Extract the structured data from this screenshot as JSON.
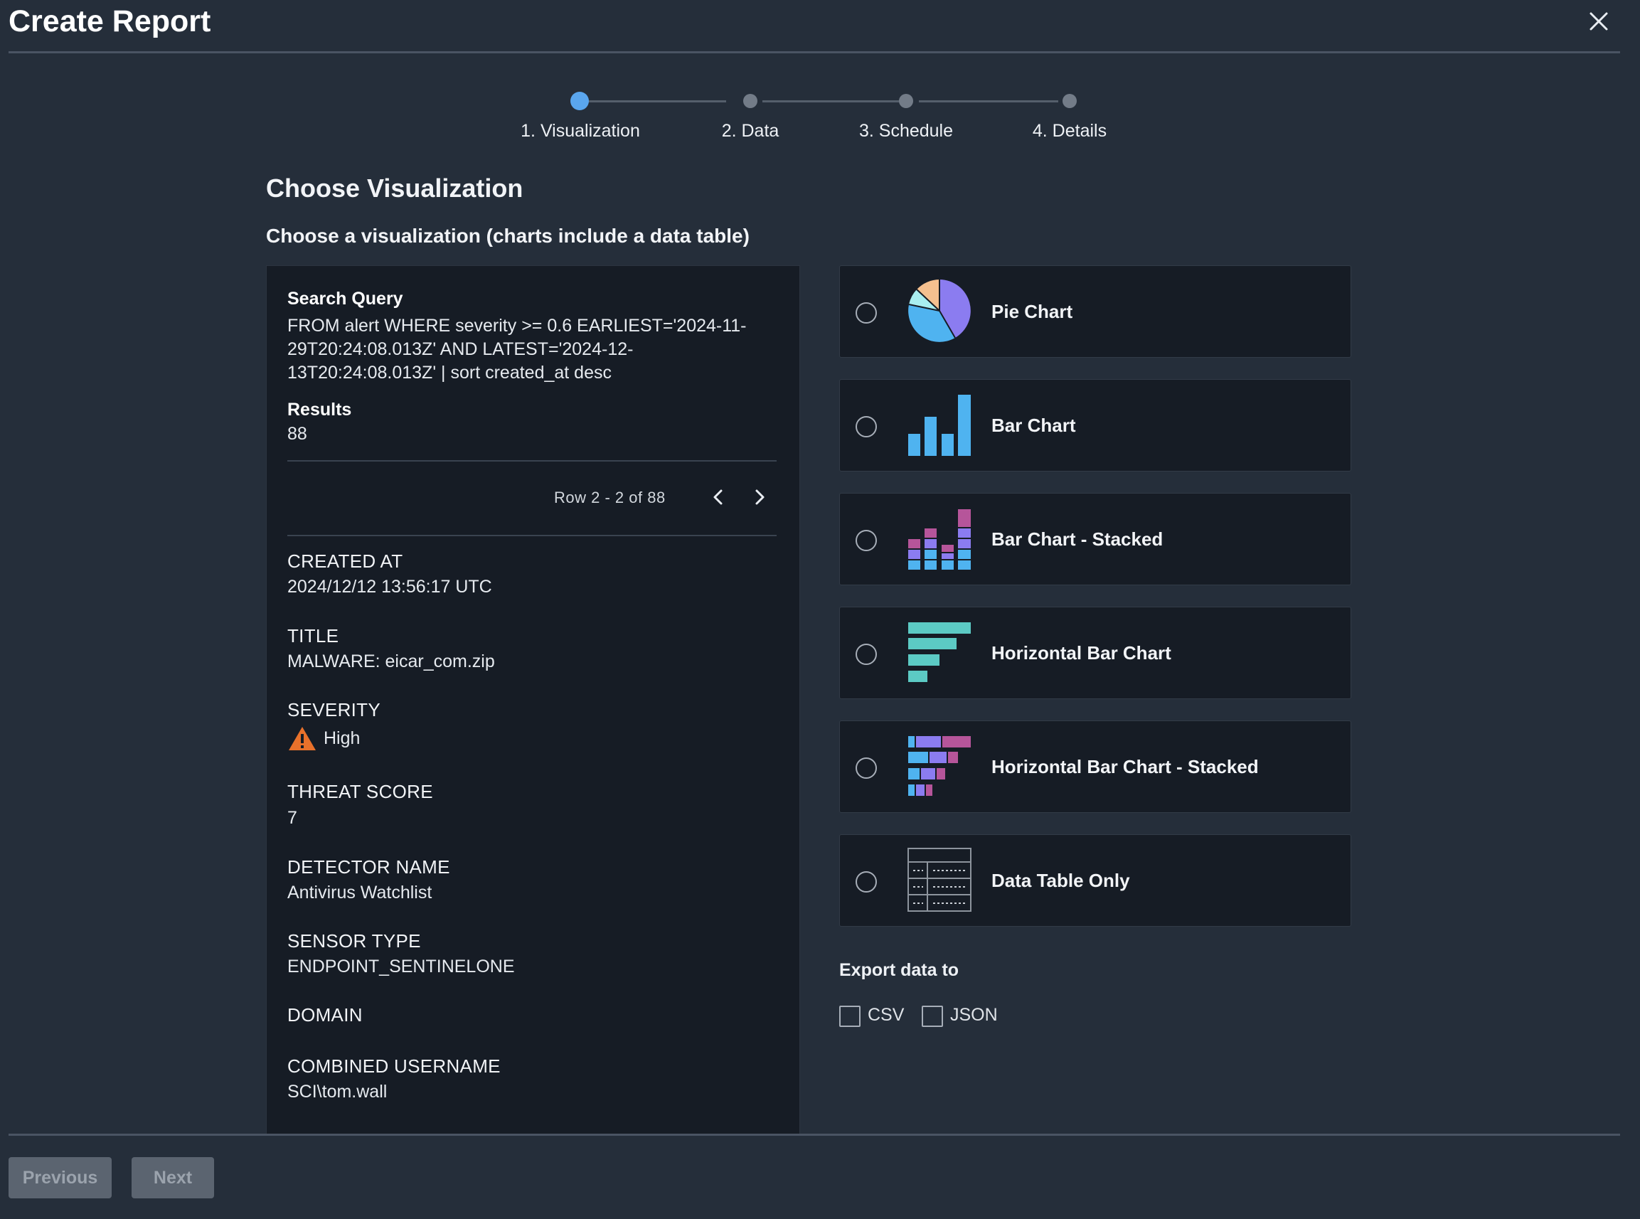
{
  "header": {
    "title": "Create Report"
  },
  "stepper": {
    "steps": [
      {
        "label": "1. Visualization",
        "state": "active"
      },
      {
        "label": "2. Data",
        "state": "inactive"
      },
      {
        "label": "3. Schedule",
        "state": "inactive"
      },
      {
        "label": "4. Details",
        "state": "inactive"
      }
    ]
  },
  "main": {
    "heading": "Choose Visualization",
    "subheading": "Choose a visualization (charts include a data table)"
  },
  "preview": {
    "query_label": "Search Query",
    "query": "FROM alert WHERE severity >= 0.6 EARLIEST='2024-11-29T20:24:08.013Z' AND LATEST='2024-12-13T20:24:08.013Z' | sort created_at desc",
    "results_label": "Results",
    "results": "88",
    "pager": "Row 2 - 2 of 88",
    "fields": [
      {
        "label": "CREATED AT",
        "value": "2024/12/12 13:56:17 UTC"
      },
      {
        "label": "TITLE",
        "value": "MALWARE: eicar_com.zip"
      },
      {
        "label": "SEVERITY",
        "value": "High"
      },
      {
        "label": "THREAT SCORE",
        "value": "7"
      },
      {
        "label": "DETECTOR NAME",
        "value": "Antivirus Watchlist"
      },
      {
        "label": "SENSOR TYPE",
        "value": "ENDPOINT_SENTINELONE"
      },
      {
        "label": "DOMAIN",
        "value": ""
      },
      {
        "label": "COMBINED USERNAME",
        "value": "SCI\\tom.wall"
      }
    ]
  },
  "visualizations": [
    {
      "label": "Pie Chart",
      "icon": "pie-chart-icon"
    },
    {
      "label": "Bar Chart",
      "icon": "bar-chart-icon"
    },
    {
      "label": "Bar Chart - Stacked",
      "icon": "stacked-bar-chart-icon"
    },
    {
      "label": "Horizontal Bar Chart",
      "icon": "horizontal-bar-chart-icon"
    },
    {
      "label": "Horizontal Bar Chart - Stacked",
      "icon": "horizontal-stacked-bar-chart-icon"
    },
    {
      "label": "Data Table Only",
      "icon": "data-table-icon"
    }
  ],
  "export": {
    "label": "Export data to",
    "options": [
      {
        "label": "CSV"
      },
      {
        "label": "JSON"
      }
    ]
  },
  "footer": {
    "previous_label": "Previous",
    "next_label": "Next"
  },
  "colors": {
    "accent": "#5aa6ee",
    "warning": "#e8712b",
    "purple": "#8b7cf0",
    "blue": "#4fb3f0",
    "teal": "#5ccac4",
    "magenta": "#b6559a",
    "peach": "#f5c08f",
    "cyan": "#a9eef0"
  }
}
